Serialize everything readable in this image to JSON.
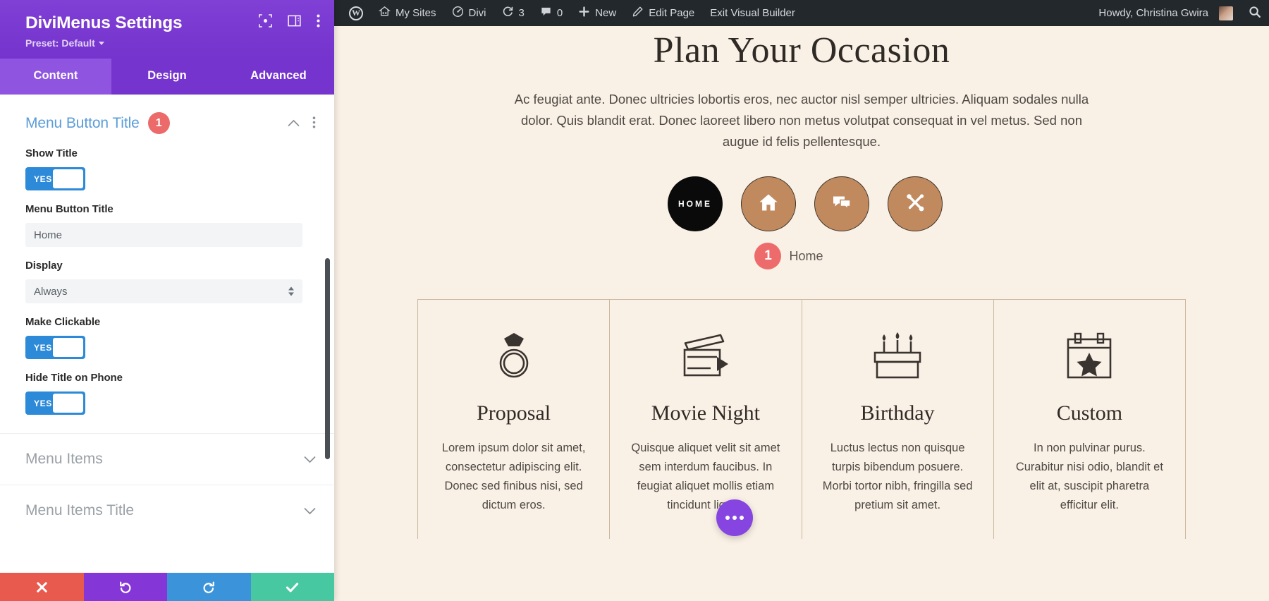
{
  "settings_panel": {
    "title": "DiviMenus Settings",
    "preset_label": "Preset: Default",
    "header_icons": [
      {
        "name": "expand-icon"
      },
      {
        "name": "layout-icon"
      },
      {
        "name": "kebab-menu-icon"
      }
    ],
    "tabs": [
      {
        "label": "Content",
        "active": true
      },
      {
        "label": "Design",
        "active": false
      },
      {
        "label": "Advanced",
        "active": false
      }
    ],
    "open_section": {
      "title": "Menu Button Title",
      "badge": "1",
      "fields": [
        {
          "type": "toggle",
          "label": "Show Title",
          "value": "YES"
        },
        {
          "type": "text",
          "label": "Menu Button Title",
          "value": "Home",
          "placeholder": "Home"
        },
        {
          "type": "select",
          "label": "Display",
          "value": "Always"
        },
        {
          "type": "toggle",
          "label": "Make Clickable",
          "value": "YES"
        },
        {
          "type": "toggle",
          "label": "Hide Title on Phone",
          "value": "YES"
        }
      ]
    },
    "closed_sections": [
      {
        "title": "Menu Items"
      },
      {
        "title": "Menu Items Title"
      }
    ],
    "footer_buttons": [
      {
        "name": "cancel-button",
        "glyph": "✖",
        "color": "#e8594e"
      },
      {
        "name": "undo-button",
        "glyph": "↺",
        "color": "#8536d6"
      },
      {
        "name": "redo-button",
        "glyph": "↻",
        "color": "#3b93d9"
      },
      {
        "name": "save-button",
        "glyph": "✔",
        "color": "#47c8a0"
      }
    ]
  },
  "adminbar": {
    "items": [
      {
        "name": "wordpress-logo-icon",
        "label": ""
      },
      {
        "name": "my-sites-item",
        "label": "My Sites"
      },
      {
        "name": "divi-item",
        "label": "Divi"
      },
      {
        "name": "updates-item",
        "label": "3"
      },
      {
        "name": "comments-item",
        "label": "0"
      },
      {
        "name": "new-item",
        "label": "New"
      },
      {
        "name": "edit-page-item",
        "label": "Edit Page"
      },
      {
        "name": "exit-visual-builder-item",
        "label": "Exit Visual Builder"
      }
    ],
    "howdy": "Howdy, Christina Gwira",
    "search_icon": "search-icon"
  },
  "page": {
    "hero_title": "Plan Your Occasion",
    "hero_paragraph": "Ac feugiat ante. Donec ultricies lobortis eros, nec auctor nisl semper ultricies. Aliquam sodales nulla dolor. Quis blandit erat. Donec laoreet libero non metus volutpat consequat in vel metus. Sed non augue id felis pellentesque.",
    "menu_buttons": [
      {
        "name": "menu-main-button",
        "label": "HOME",
        "type": "label",
        "bg": "#0a0a0a"
      },
      {
        "name": "menu-home-button",
        "icon": "house-icon",
        "type": "icon",
        "bg": "#c18a5e"
      },
      {
        "name": "menu-chat-button",
        "icon": "chat-bubbles-icon",
        "type": "icon",
        "bg": "#c18a5e"
      },
      {
        "name": "menu-tools-button",
        "icon": "tools-icon",
        "type": "icon",
        "bg": "#c18a5e"
      }
    ],
    "selected_item": {
      "badge": "1",
      "label": "Home"
    },
    "cards": [
      {
        "icon": "ring-icon",
        "title": "Proposal",
        "text": "Lorem ipsum dolor sit amet, consectetur adipiscing elit. Donec sed finibus nisi, sed dictum eros."
      },
      {
        "icon": "clapperboard-icon",
        "title": "Movie Night",
        "text": "Quisque aliquet velit sit amet sem interdum faucibus. In feugiat aliquet mollis etiam tincidunt ligula."
      },
      {
        "icon": "birthday-cake-icon",
        "title": "Birthday",
        "text": "Luctus lectus non quisque turpis bibendum posuere. Morbi tortor nibh, fringilla sed pretium sit amet."
      },
      {
        "icon": "calendar-star-icon",
        "title": "Custom",
        "text": "In non pulvinar purus. Curabitur nisi odio, blandit et elit at, suscipit pharetra efficitur elit."
      }
    ],
    "fab": {
      "name": "page-settings-fab",
      "icon": "ellipsis-icon"
    }
  },
  "colors": {
    "panel_purple": "#7434cd",
    "tab_active": "#8f55e0",
    "toggle_blue": "#2d8ad8",
    "badge_red": "#ec6a6a",
    "section_blue": "#5b9dd9",
    "canvas_cream": "#faf1e6",
    "circle_brown": "#c18a5e",
    "adminbar_dark": "#23282d"
  }
}
